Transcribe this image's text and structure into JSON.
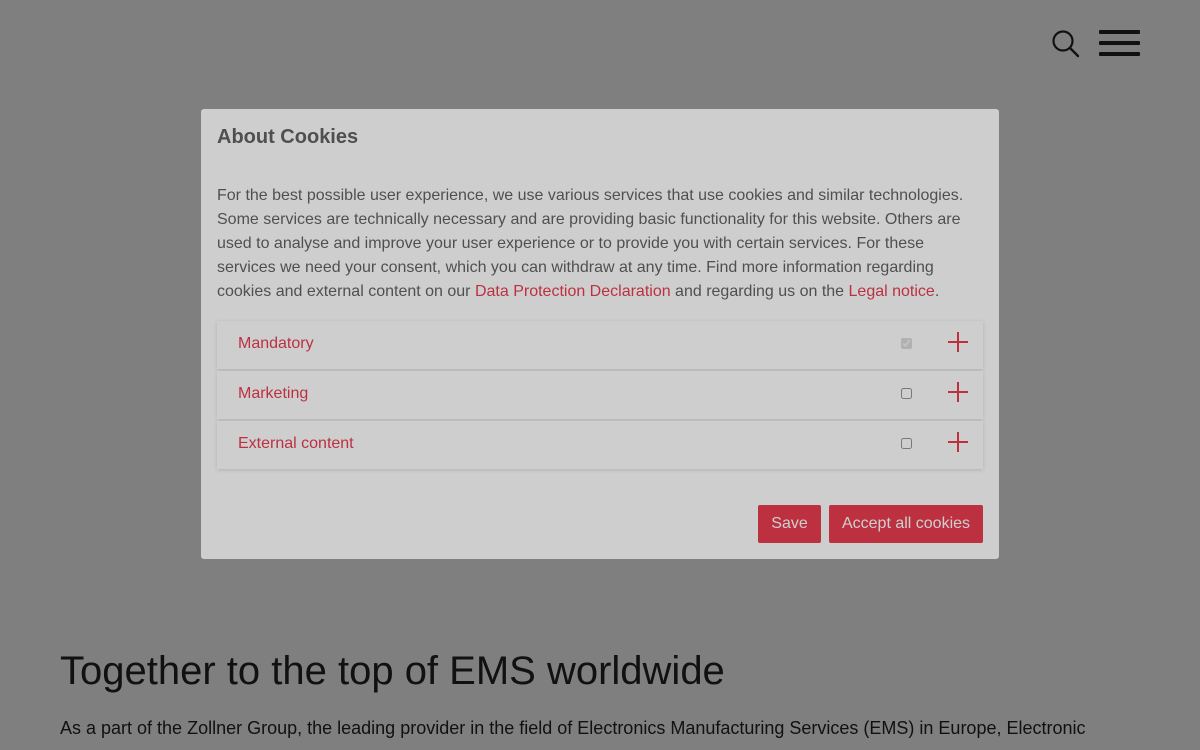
{
  "header": {
    "search_icon": "search-icon",
    "menu_icon": "hamburger-menu-icon"
  },
  "content": {
    "heading": "Together to the top of EMS worldwide",
    "paragraph": "As a part of the Zollner Group, the leading provider in the field of Electronics Manufacturing Services (EMS) in Europe, Electronic"
  },
  "cookie_modal": {
    "title": "About Cookies",
    "text_part1": "For the best possible user experience, we use various services that use cookies and similar technologies. Some services are technically necessary and are providing basic functionality for this website. Others are used to analyse and improve your user experience or to provide you with certain services. For these services we need your consent, which you can withdraw at any time. Find more information regarding cookies and external content on our ",
    "link_privacy": "Data Protection Declaration",
    "text_part2": " and regarding us on the ",
    "link_legal": "Legal notice",
    "text_part3": ".",
    "categories": [
      {
        "label": "Mandatory",
        "checked": true,
        "disabled": true
      },
      {
        "label": "Marketing",
        "checked": false,
        "disabled": false
      },
      {
        "label": "External content",
        "checked": false,
        "disabled": false
      }
    ],
    "save_label": "Save",
    "accept_label": "Accept all cookies"
  },
  "colors": {
    "accent": "#e2001a",
    "overlay": "rgba(0,0,0,0.5)"
  }
}
